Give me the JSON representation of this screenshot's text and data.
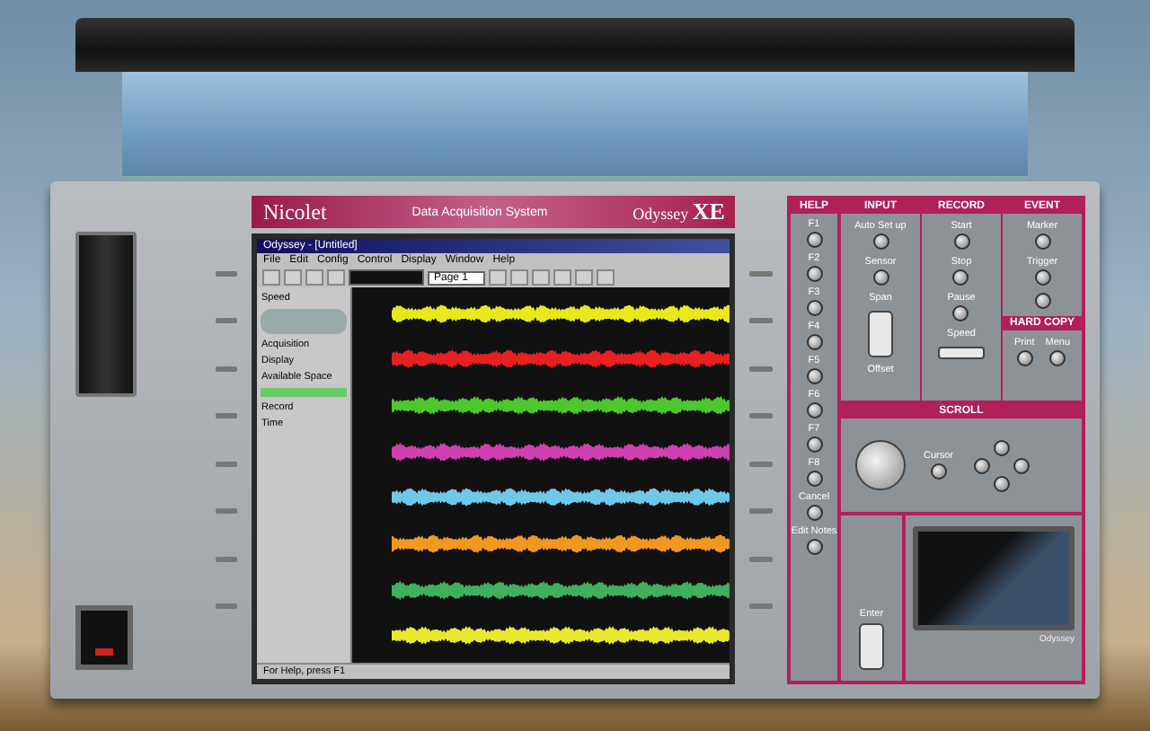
{
  "brand_bar": {
    "logo": "Nicolet",
    "title": "Data Acquisition System",
    "model": "Odyssey",
    "model_mark": "XE"
  },
  "app": {
    "title": "Odyssey - [Untitled]",
    "menu": [
      "File",
      "Edit",
      "Config",
      "Control",
      "Display",
      "Window",
      "Help"
    ],
    "page_select": "Page 1",
    "side_labels": [
      "Speed",
      "Acquisition",
      "Display",
      "Available Space",
      "Record",
      "Time"
    ],
    "channels": [
      {
        "color": "#e8e81c"
      },
      {
        "color": "#e82020"
      },
      {
        "color": "#4cc82c"
      },
      {
        "color": "#d040b0"
      },
      {
        "color": "#70c8e8"
      },
      {
        "color": "#f09820"
      },
      {
        "color": "#40b060"
      },
      {
        "color": "#e8e830"
      }
    ],
    "status_left": "For Help, press F1"
  },
  "panel": {
    "help": {
      "title": "HELP",
      "keys": [
        "F1",
        "F2",
        "F3",
        "F4",
        "F5",
        "F6",
        "F7",
        "F8",
        "Cancel",
        "Edit Notes"
      ]
    },
    "sections": [
      {
        "kind": "input",
        "title": "INPUT",
        "buttons": [
          "Auto Set up",
          "Sensor"
        ],
        "rocker_top": "Span",
        "rocker_bottom": "Offset"
      },
      {
        "kind": "record",
        "title": "RECORD",
        "buttons": [
          "Start",
          "Stop",
          "Pause"
        ],
        "slider": "Speed"
      },
      {
        "kind": "event",
        "title": "EVENT",
        "buttons": [
          "Marker",
          "Trigger"
        ],
        "sub_title": "HARD COPY",
        "sub_buttons": [
          "Print",
          "Menu"
        ]
      }
    ],
    "scroll": {
      "title": "SCROLL",
      "cursor": "Cursor",
      "enter": "Enter"
    },
    "printer_badge": "Odyssey"
  }
}
